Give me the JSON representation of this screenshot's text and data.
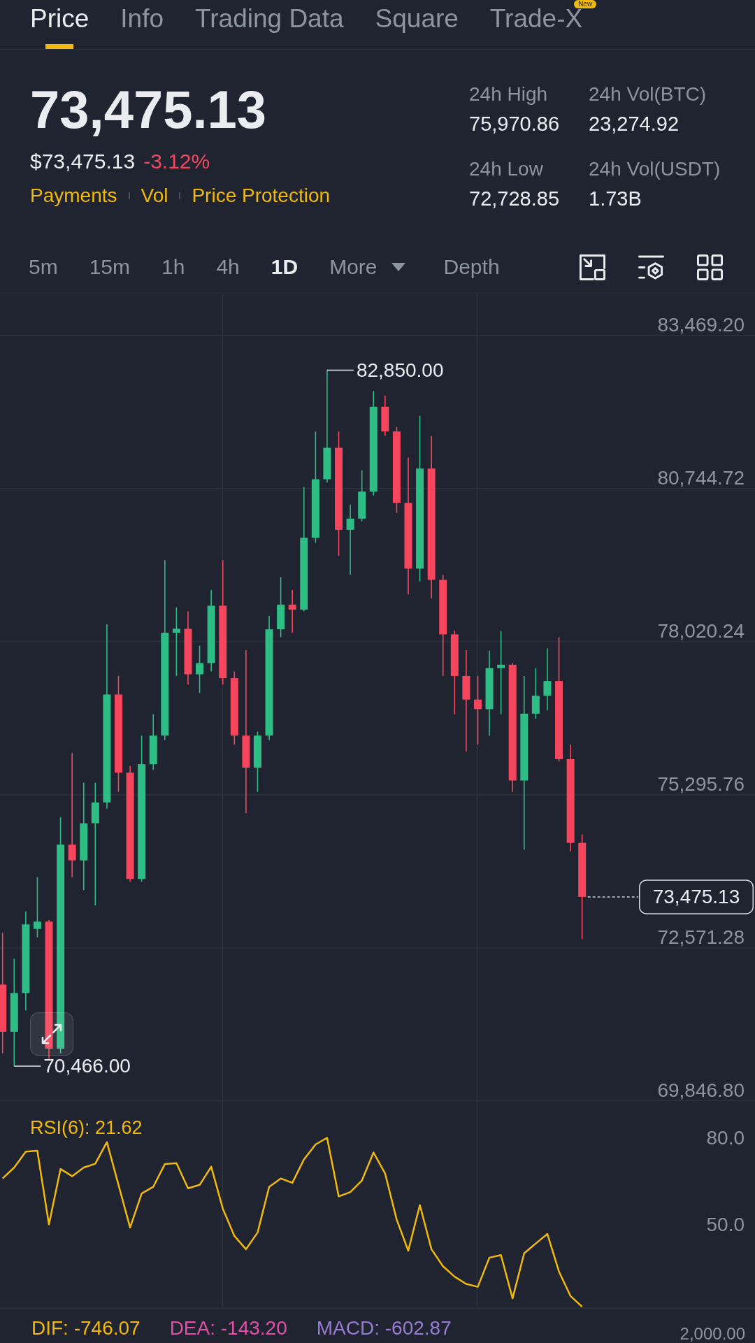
{
  "tabs": [
    {
      "label": "Price",
      "selected": true
    },
    {
      "label": "Info",
      "selected": false
    },
    {
      "label": "Trading Data",
      "selected": false
    },
    {
      "label": "Square",
      "selected": false
    },
    {
      "label": "Trade-X",
      "selected": false,
      "badge": "New"
    }
  ],
  "ticker": {
    "last_price": "73,475.13",
    "usd_price": "$73,475.13",
    "change": "-3.12%",
    "falling": true,
    "links": [
      "Payments",
      "Vol",
      "Price Protection"
    ],
    "stats": [
      {
        "label": "24h High",
        "value": "75,970.86"
      },
      {
        "label": "24h Vol(BTC)",
        "value": "23,274.92"
      },
      {
        "label": "24h Low",
        "value": "72,728.85"
      },
      {
        "label": "24h Vol(USDT)",
        "value": "1.73B"
      }
    ]
  },
  "intervals": [
    {
      "label": "5m",
      "kind": "interval",
      "selected": false
    },
    {
      "label": "15m",
      "kind": "interval",
      "selected": false
    },
    {
      "label": "1h",
      "kind": "interval",
      "selected": false
    },
    {
      "label": "4h",
      "kind": "interval",
      "selected": false
    },
    {
      "label": "1D",
      "kind": "interval",
      "selected": true
    },
    {
      "label": "More",
      "kind": "menu",
      "selected": false
    },
    {
      "label": "Depth",
      "kind": "view",
      "selected": false
    }
  ],
  "price_chart": {
    "high_label": "82,850.00",
    "low_label": "70,466.00",
    "last_price_label": "73,475.13",
    "chart_data": {
      "type": "candlestick",
      "grid": true,
      "ylim": [
        69846.8,
        84200
      ],
      "yticks": [
        {
          "value": 83469.2,
          "label": "83,469.20"
        },
        {
          "value": 80744.72,
          "label": "80,744.72"
        },
        {
          "value": 78020.24,
          "label": "78,020.24"
        },
        {
          "value": 75295.76,
          "label": "75,295.76"
        },
        {
          "value": 72571.28,
          "label": "72,571.28"
        },
        {
          "value": 69846.8,
          "label": "69,846.80"
        }
      ],
      "categories": [
        null,
        null,
        null,
        null,
        null,
        null,
        null,
        null,
        null,
        null,
        null,
        null,
        null,
        null,
        null,
        null,
        null,
        null,
        null,
        null,
        null,
        null,
        null,
        null,
        null,
        null,
        null,
        null,
        null,
        null,
        null,
        null,
        null,
        null,
        null,
        null,
        null,
        null,
        null,
        null,
        null,
        null,
        null,
        null,
        null,
        null,
        null,
        null,
        null,
        null,
        null
      ],
      "ohlc": [
        [
          71920,
          72840,
          70700,
          71080
        ],
        [
          71080,
          72380,
          70470,
          71770
        ],
        [
          71770,
          73220,
          71460,
          72990
        ],
        [
          72910,
          73830,
          72760,
          73040
        ],
        [
          73040,
          73070,
          70600,
          70780
        ],
        [
          70780,
          74900,
          70700,
          74410
        ],
        [
          74410,
          76040,
          73830,
          74130
        ],
        [
          74130,
          75510,
          73600,
          74790
        ],
        [
          74790,
          75510,
          73330,
          75160
        ],
        [
          75160,
          78330,
          75050,
          77080
        ],
        [
          77080,
          77410,
          75350,
          75690
        ],
        [
          75690,
          75810,
          73750,
          73800
        ],
        [
          73800,
          76350,
          73750,
          75840
        ],
        [
          75840,
          76730,
          75740,
          76350
        ],
        [
          76350,
          79470,
          76270,
          78180
        ],
        [
          78180,
          78630,
          77410,
          78250
        ],
        [
          78250,
          78560,
          77260,
          77440
        ],
        [
          77440,
          77950,
          77110,
          77640
        ],
        [
          77640,
          78940,
          77490,
          78660
        ],
        [
          78660,
          79470,
          77260,
          77370
        ],
        [
          77370,
          77490,
          76190,
          76350
        ],
        [
          76350,
          77870,
          74970,
          75780
        ],
        [
          75780,
          76420,
          75350,
          76350
        ],
        [
          76350,
          78480,
          76270,
          78240
        ],
        [
          78240,
          79170,
          78100,
          78680
        ],
        [
          78680,
          78940,
          78180,
          78590
        ],
        [
          78590,
          80770,
          78560,
          79870
        ],
        [
          79870,
          81760,
          79780,
          80910
        ],
        [
          80910,
          82850,
          80850,
          81470
        ],
        [
          81470,
          81760,
          79550,
          80010
        ],
        [
          80010,
          80460,
          79210,
          80210
        ],
        [
          80210,
          81070,
          80160,
          80690
        ],
        [
          80690,
          82480,
          80620,
          82200
        ],
        [
          82200,
          82400,
          81680,
          81760
        ],
        [
          81760,
          81840,
          80310,
          80490
        ],
        [
          80490,
          81300,
          78860,
          79320
        ],
        [
          79320,
          82040,
          79090,
          81100
        ],
        [
          81100,
          81680,
          78790,
          79120
        ],
        [
          79120,
          79210,
          77410,
          78150
        ],
        [
          78150,
          78220,
          76730,
          77410
        ],
        [
          77410,
          77870,
          76070,
          76990
        ],
        [
          76990,
          77410,
          76190,
          76820
        ],
        [
          76820,
          77860,
          76350,
          77550
        ],
        [
          77550,
          78210,
          76730,
          77610
        ],
        [
          77610,
          77640,
          75350,
          75550
        ],
        [
          75550,
          77410,
          74320,
          76740
        ],
        [
          76740,
          77550,
          76650,
          77060
        ],
        [
          77060,
          77900,
          76800,
          77320
        ],
        [
          77320,
          78100,
          75890,
          75930
        ],
        [
          75930,
          76190,
          74290,
          74440
        ],
        [
          74440,
          74590,
          72730,
          73480
        ]
      ]
    }
  },
  "rsi": {
    "label": "RSI(6): 21.62",
    "chart_data": {
      "type": "line",
      "grid": true,
      "ylim": [
        20.9,
        92.8
      ],
      "yticks": [
        {
          "value": 80,
          "label": "80.0"
        },
        {
          "value": 50,
          "label": "50.0"
        }
      ],
      "categories": [
        null,
        null,
        null,
        null,
        null,
        null,
        null,
        null,
        null,
        null,
        null,
        null,
        null,
        null,
        null,
        null,
        null,
        null,
        null,
        null,
        null,
        null,
        null,
        null,
        null,
        null,
        null,
        null,
        null,
        null,
        null,
        null,
        null,
        null,
        null,
        null,
        null,
        null,
        null,
        null,
        null,
        null,
        null,
        null,
        null,
        null,
        null,
        null,
        null,
        null,
        null
      ],
      "values": [
        66.0,
        69.8,
        75.3,
        75.6,
        50.1,
        69.3,
        66.8,
        69.8,
        71.1,
        78.6,
        63.8,
        49.0,
        60.8,
        63.1,
        71.0,
        71.3,
        62.6,
        63.8,
        70.1,
        55.6,
        46.1,
        41.5,
        47.3,
        63.1,
        66.0,
        64.5,
        72.6,
        77.8,
        80.1,
        59.8,
        61.3,
        65.3,
        75.0,
        67.8,
        51.8,
        41.0,
        56.8,
        41.5,
        35.6,
        32.0,
        29.5,
        28.5,
        38.6,
        39.5,
        24.5,
        40.1,
        43.5,
        46.8,
        33.8,
        25.3,
        21.6
      ]
    }
  },
  "macd": {
    "items": [
      {
        "text": "DIF: -746.07",
        "color": "#f0b90b"
      },
      {
        "text": "DEA: -143.20",
        "color": "#e24fa8"
      },
      {
        "text": "MACD: -602.87",
        "color": "#9a7bd5"
      }
    ],
    "axis_label": "2,000.00"
  }
}
